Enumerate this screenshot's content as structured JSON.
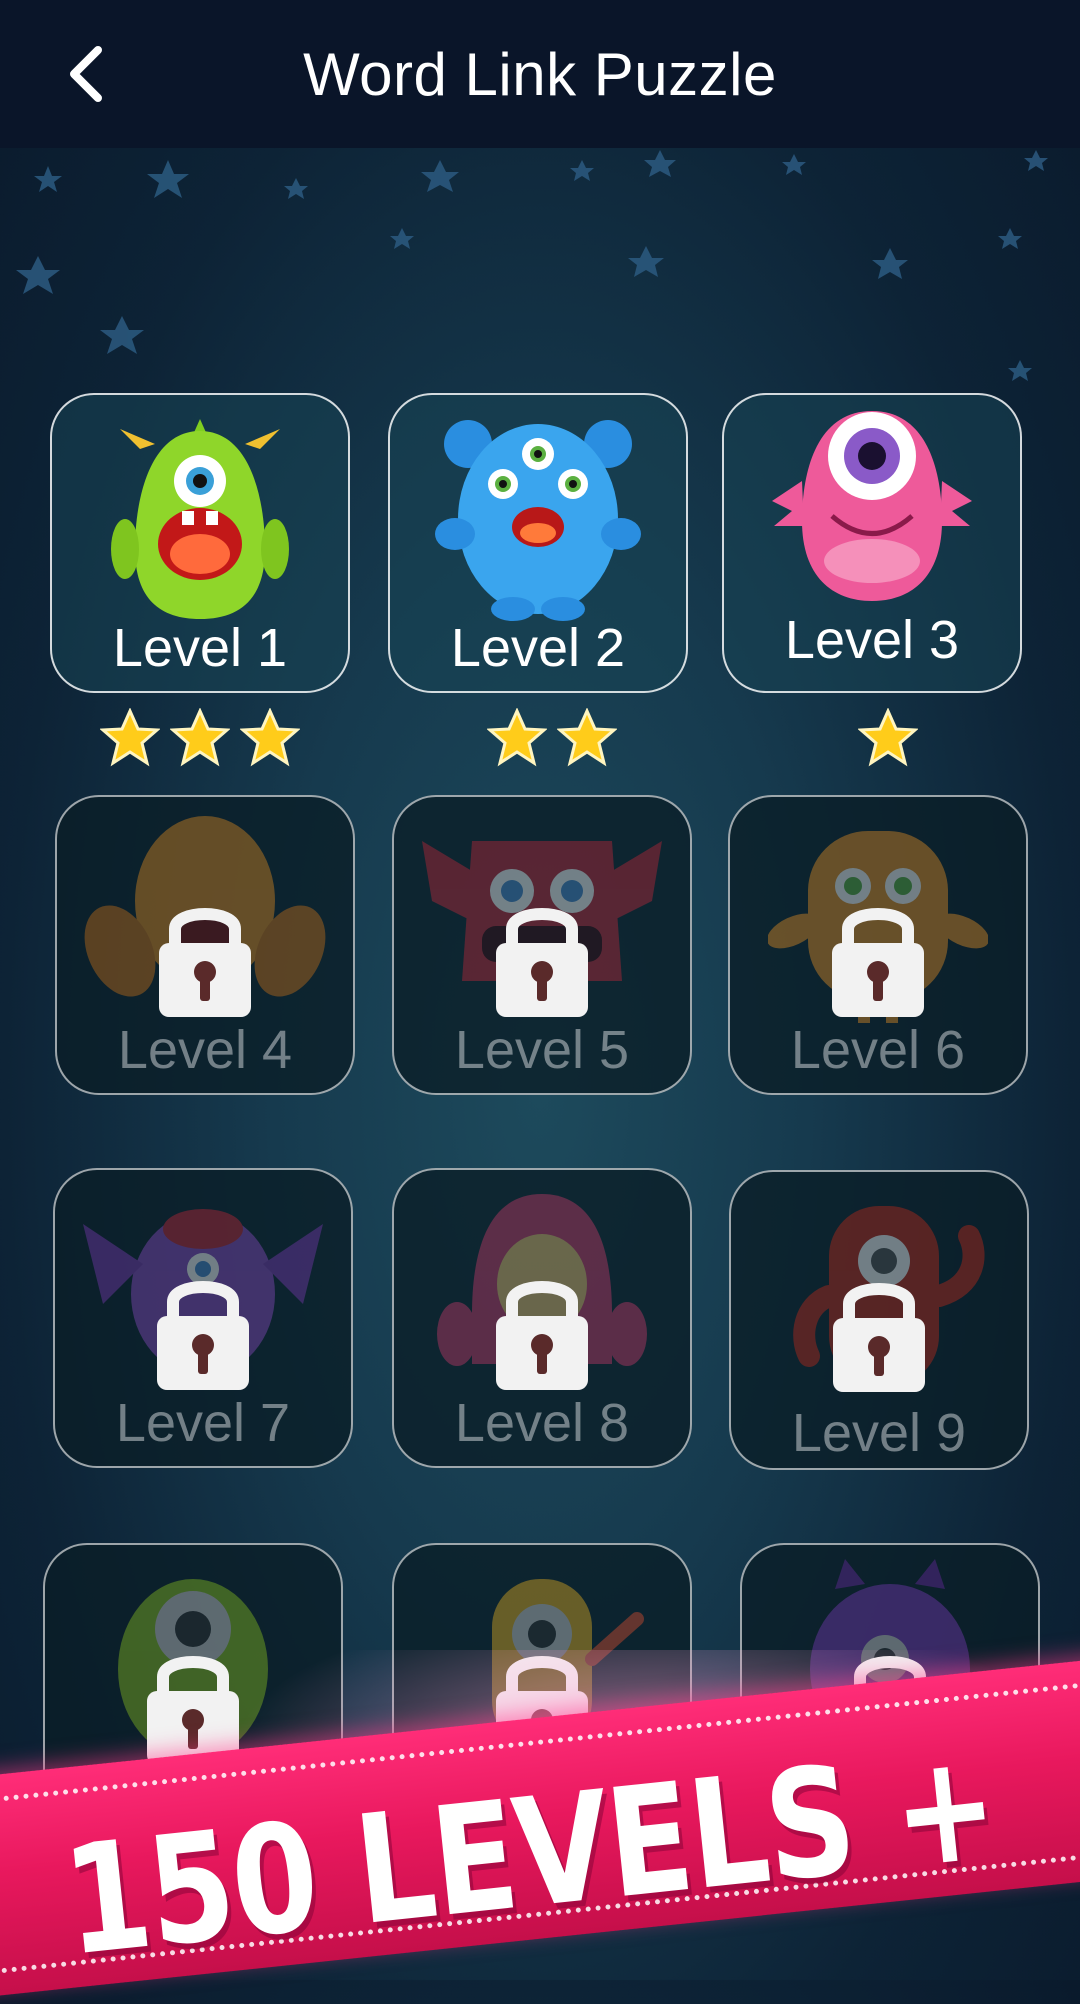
{
  "header": {
    "title": "Word Link Puzzle",
    "back_icon": "chevron-left-icon"
  },
  "levels": [
    {
      "label": "Level 1",
      "locked": false,
      "stars": 3,
      "monster": "green-horned-monster"
    },
    {
      "label": "Level 2",
      "locked": false,
      "stars": 2,
      "monster": "blue-three-eyed-monster"
    },
    {
      "label": "Level 3",
      "locked": false,
      "stars": 1,
      "monster": "pink-cyclops-monster"
    },
    {
      "label": "Level 4",
      "locked": true,
      "stars": 0,
      "monster": "orange-furry-monster"
    },
    {
      "label": "Level 5",
      "locked": true,
      "stars": 0,
      "monster": "red-furry-monster"
    },
    {
      "label": "Level 6",
      "locked": true,
      "stars": 0,
      "monster": "orange-stitched-monster"
    },
    {
      "label": "Level 7",
      "locked": true,
      "stars": 0,
      "monster": "purple-winged-monster"
    },
    {
      "label": "Level 8",
      "locked": true,
      "stars": 0,
      "monster": "pink-hooded-monster"
    },
    {
      "label": "Level 9",
      "locked": true,
      "stars": 0,
      "monster": "red-cyclops-monster"
    },
    {
      "label": "",
      "locked": true,
      "stars": 0,
      "monster": "green-cyclops-monster"
    },
    {
      "label": "",
      "locked": true,
      "stars": 0,
      "monster": "yellow-cyclops-monster"
    },
    {
      "label": "",
      "locked": true,
      "stars": 0,
      "monster": "purple-horned-monster"
    }
  ],
  "banner": {
    "text": "150 LEVELS +"
  },
  "colors": {
    "header_bg": "#0a1529",
    "star_gold": "#ffcc1a",
    "banner_pink": "#e8185d"
  }
}
